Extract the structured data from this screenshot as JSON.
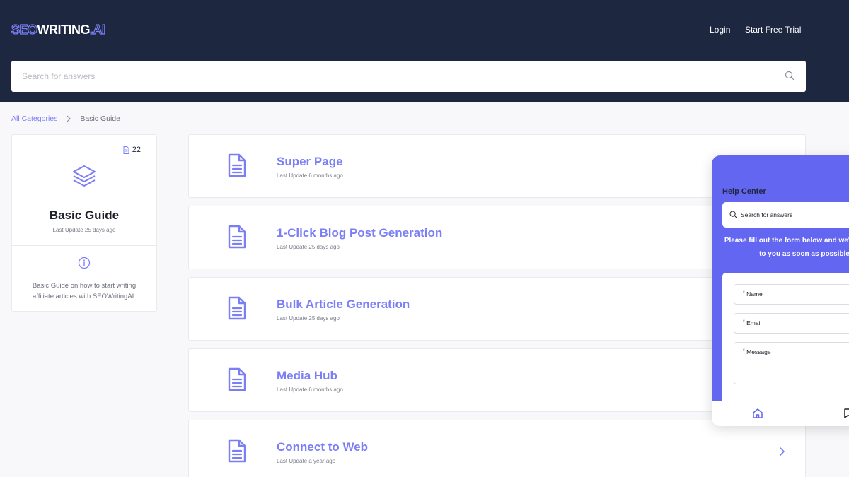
{
  "header": {
    "logo": {
      "part1": "SEO",
      "part2": "WRITING",
      "part3": ".AI"
    },
    "nav": {
      "login": "Login",
      "trial": "Start Free Trial"
    },
    "search": {
      "placeholder": "Search for answers"
    }
  },
  "breadcrumb": {
    "root": "All Categories",
    "current": "Basic Guide"
  },
  "category": {
    "count": "22",
    "title": "Basic Guide",
    "last_update": "Last Update 25 days ago",
    "description": "Basic Guide on how to start writing affiliate articles with SEOWritingAI."
  },
  "articles": [
    {
      "title": "Super Page",
      "update": "Last Update 6 months ago"
    },
    {
      "title": "1-Click Blog Post Generation",
      "update": "Last Update 25 days ago"
    },
    {
      "title": "Bulk Article Generation",
      "update": "Last Update 25 days ago"
    },
    {
      "title": "Media Hub",
      "update": "Last Update 6 months ago"
    },
    {
      "title": "Connect to Web",
      "update": "Last Update a year ago"
    }
  ],
  "widget": {
    "title": "Help Center",
    "search_placeholder": "Search for answers",
    "message": "Please fill out the form below and we'll get back to you as soon as possible",
    "form": {
      "name": "Name",
      "email": "Email",
      "message": "Message",
      "required_mark": "*"
    }
  },
  "colors": {
    "header_bg": "#1d2740",
    "accent": "#7b7ff5",
    "widget_bg": "#6366f1"
  },
  "icons": {
    "search": "search-icon",
    "document": "document-icon",
    "layers": "layers-icon",
    "info": "info-icon",
    "chevron": "chevron-right-icon",
    "home": "home-icon",
    "chat": "chat-icon"
  }
}
